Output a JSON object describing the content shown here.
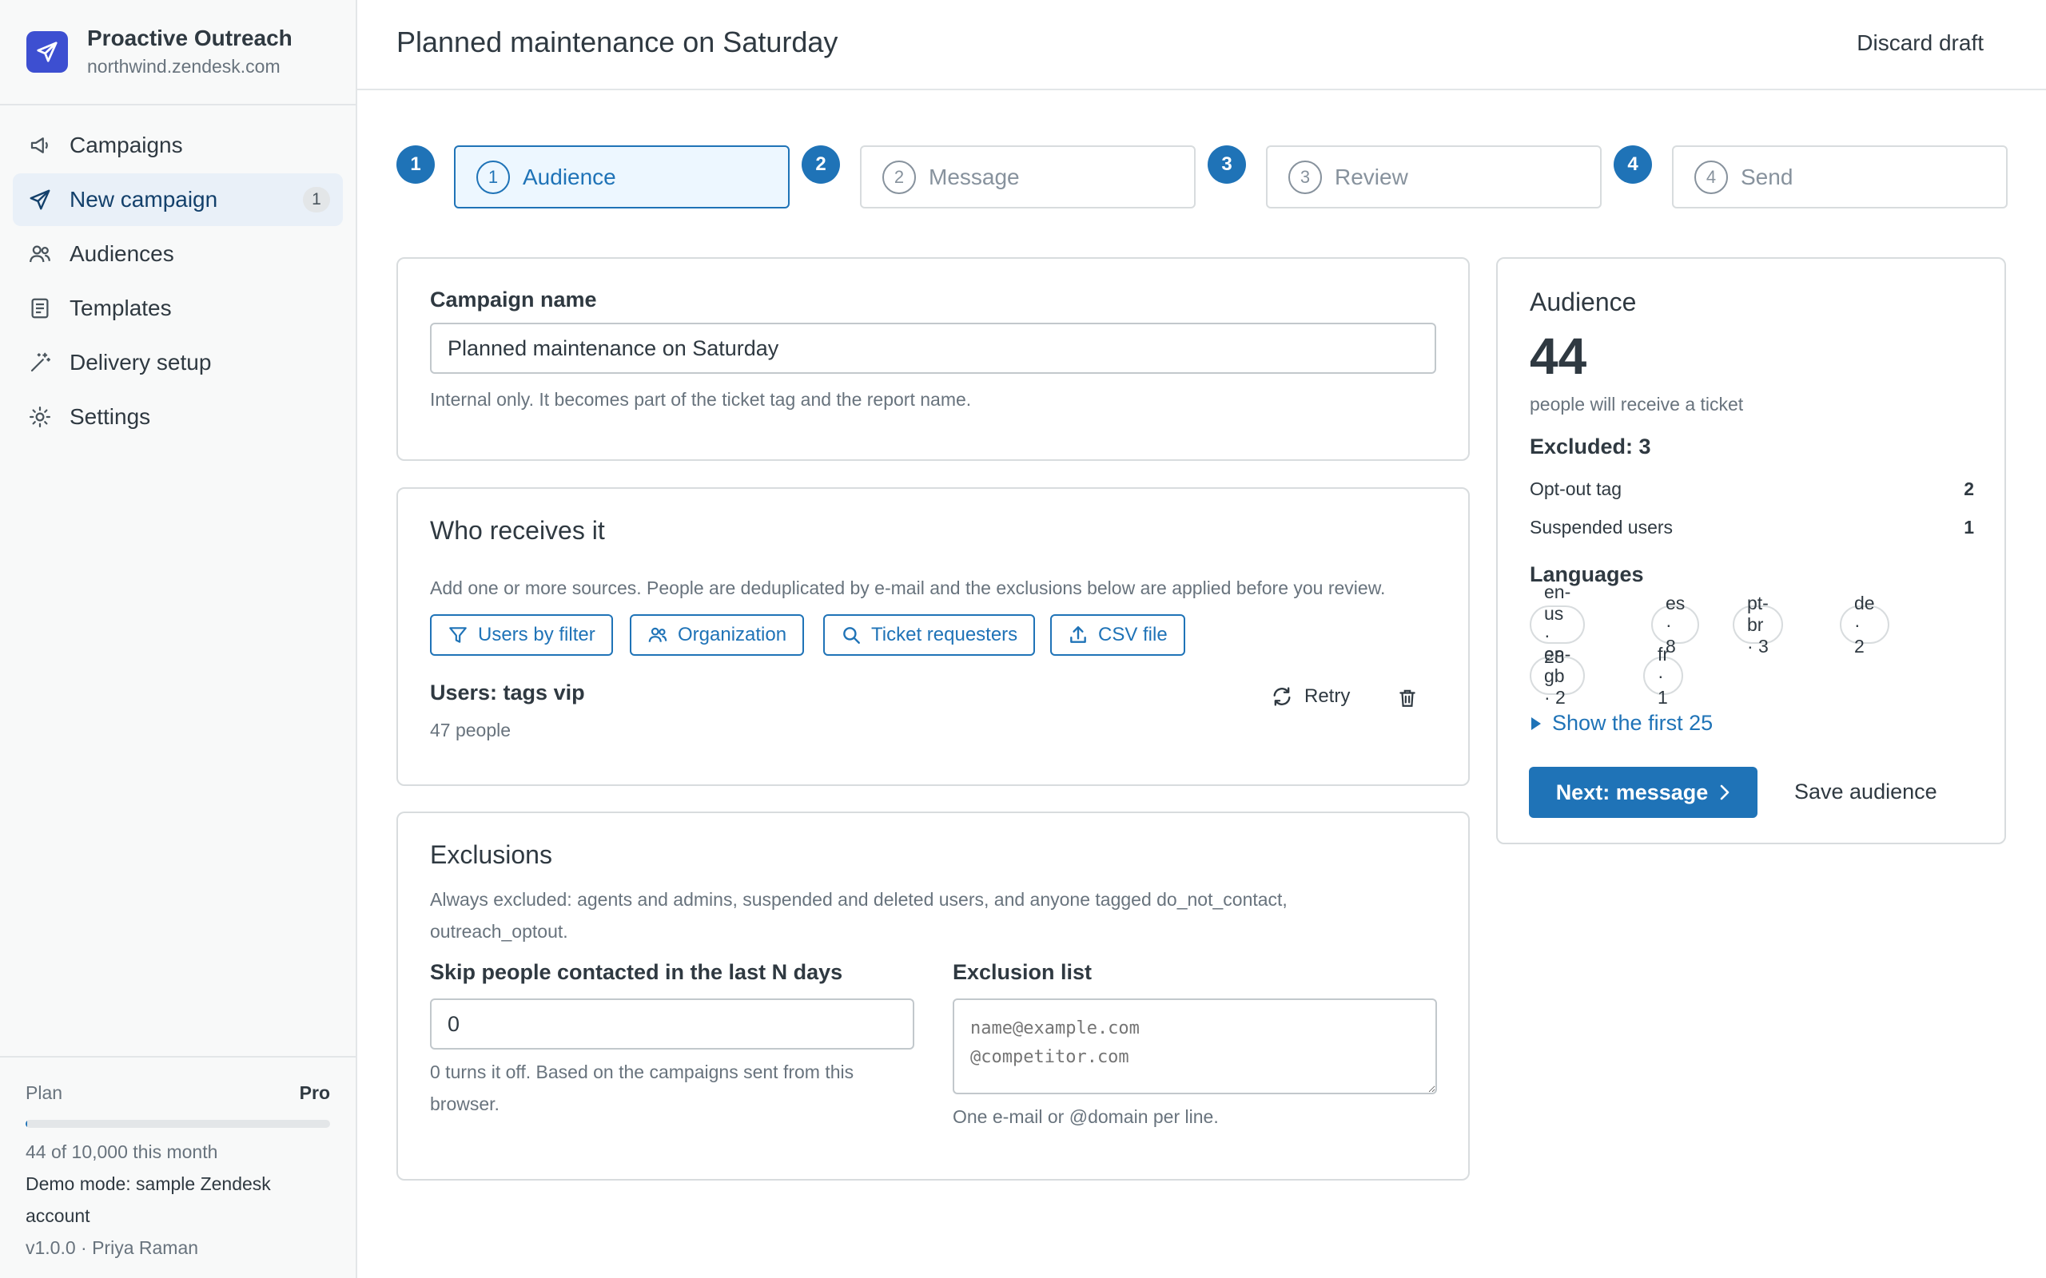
{
  "app": {
    "name": "Proactive Outreach",
    "subdomain": "northwind.zendesk.com",
    "brand_color": "#3d4fd1",
    "logo_icon": "paper-plane-icon"
  },
  "nav": {
    "items": [
      {
        "label": "Campaigns",
        "icon": "megaphone-icon"
      },
      {
        "label": "New campaign",
        "icon": "paper-plane-icon",
        "badge": "1",
        "active": true
      },
      {
        "label": "Audiences",
        "icon": "users-icon"
      },
      {
        "label": "Templates",
        "icon": "document-icon"
      },
      {
        "label": "Delivery setup",
        "icon": "magic-wand-icon"
      },
      {
        "label": "Settings",
        "icon": "gear-icon"
      }
    ]
  },
  "plan": {
    "label": "Plan",
    "tier": "Pro",
    "usage_fraction": 0.0044,
    "usage_text": "44 of 10,000 this month",
    "demo_text": "Demo mode: sample Zendesk account",
    "version_text": "v1.0.0 · Priya Raman"
  },
  "header": {
    "title": "Planned maintenance on Saturday",
    "discard": "Discard draft"
  },
  "steps": [
    {
      "num": "1",
      "label": "Audience",
      "active": true
    },
    {
      "num": "2",
      "label": "Message",
      "active": false
    },
    {
      "num": "3",
      "label": "Review",
      "active": false
    },
    {
      "num": "4",
      "label": "Send",
      "active": false
    }
  ],
  "campaign_name": {
    "label": "Campaign name",
    "value": "Planned maintenance on Saturday",
    "hint": "Internal only. It becomes part of the ticket tag and the report name."
  },
  "recipients": {
    "title": "Who receives it",
    "description": "Add one or more sources. People are deduplicated by e-mail and the exclusions below are applied before you review.",
    "source_buttons": [
      {
        "label": "Users by filter",
        "icon": "filter-icon"
      },
      {
        "label": "Organization",
        "icon": "users-icon"
      },
      {
        "label": "Ticket requesters",
        "icon": "search-icon"
      },
      {
        "label": "CSV file",
        "icon": "upload-icon"
      }
    ],
    "source": {
      "title": "Users: tags vip",
      "count": "47 people",
      "retry": "Retry"
    }
  },
  "exclusions": {
    "title": "Exclusions",
    "description": "Always excluded: agents and admins, suspended and deleted users, and anyone tagged do_not_contact, outreach_optout.",
    "skip_label": "Skip people contacted in the last N days",
    "skip_value": "0",
    "skip_hint": "0 turns it off. Based on the campaigns sent from this browser.",
    "list_label": "Exclusion list",
    "list_placeholder": "name@example.com\n@competitor.com",
    "list_hint": "One e-mail or @domain per line."
  },
  "audience_summary": {
    "title": "Audience",
    "count": "44",
    "count_caption": "people will receive a ticket",
    "excluded_title": "Excluded: 3",
    "excluded_rows": [
      {
        "label": "Opt-out tag",
        "value": "2"
      },
      {
        "label": "Suspended users",
        "value": "1"
      }
    ],
    "languages_title": "Languages",
    "languages": [
      "en-us · 28",
      "es · 8",
      "pt-br · 3",
      "de · 2",
      "en-gb · 2",
      "fr · 1"
    ],
    "show_first": "Show the first 25",
    "next_button": "Next: message",
    "save_button": "Save audience"
  }
}
